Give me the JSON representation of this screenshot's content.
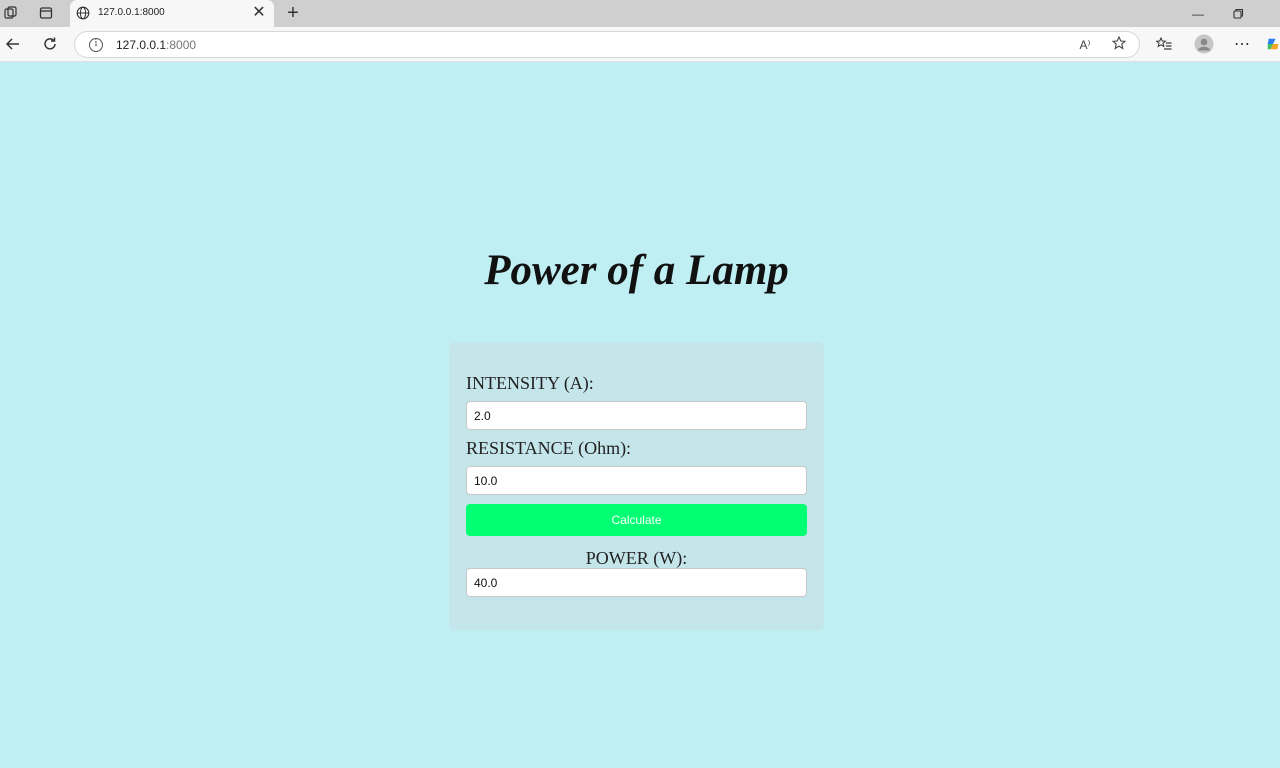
{
  "browser": {
    "tab_title": "127.0.0.1:8000",
    "url_host": "127.0.0.1",
    "url_port": ":8000",
    "read_aloud_label": "A⁾"
  },
  "page": {
    "title": "Power of a Lamp",
    "intensity_label": "INTENSITY (A):",
    "intensity_value": "2.0",
    "resistance_label": "RESISTANCE (Ohm):",
    "resistance_value": "10.0",
    "calculate_label": "Calculate",
    "power_label": "POWER (W):",
    "power_value": "40.0"
  },
  "colors": {
    "background": "#bfeef3",
    "card": "#c4e5ea",
    "button": "#00ff72"
  }
}
